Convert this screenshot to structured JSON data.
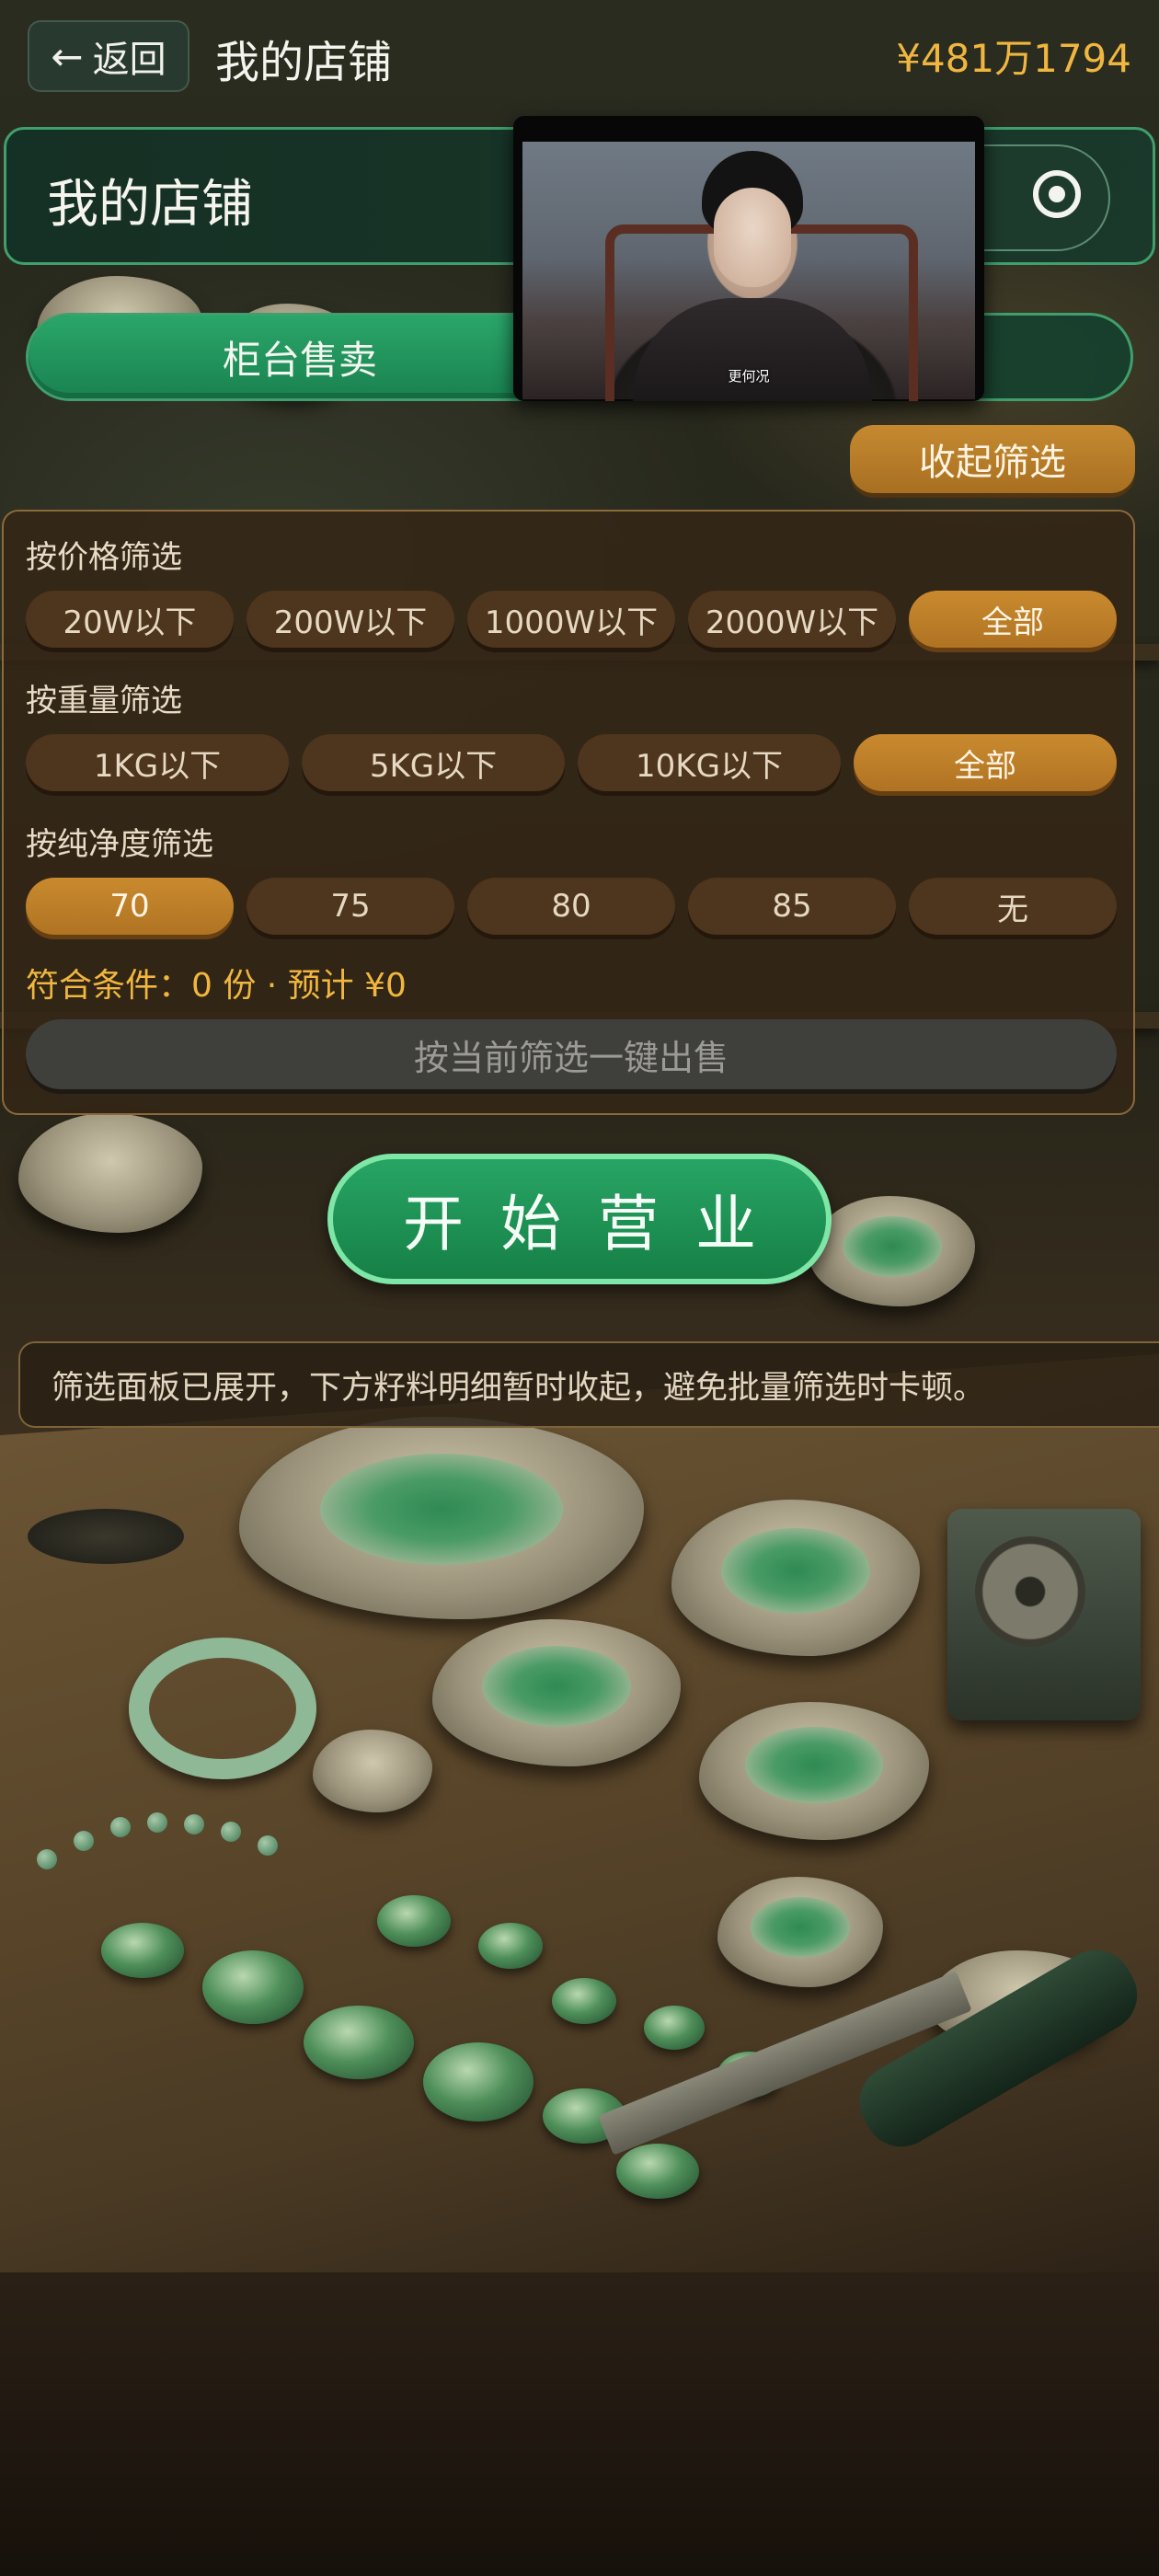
{
  "header": {
    "back_label": "返回",
    "back_icon": "arrow-left-icon",
    "title": "我的店铺",
    "balance": "¥481万1794"
  },
  "shop_card": {
    "name": "我的店铺",
    "radio_icon": "radio-selected-icon"
  },
  "tabs": {
    "active_label": "柜台售卖"
  },
  "video": {
    "caption": "更何况"
  },
  "filter": {
    "collapse_label": "收起筛选",
    "price": {
      "label": "按价格筛选",
      "options": [
        "20W以下",
        "200W以下",
        "1000W以下",
        "2000W以下",
        "全部"
      ],
      "selected": "全部"
    },
    "weight": {
      "label": "按重量筛选",
      "options": [
        "1KG以下",
        "5KG以下",
        "10KG以下",
        "全部"
      ],
      "selected": "全部"
    },
    "purity": {
      "label": "按纯净度筛选",
      "options": [
        "70",
        "75",
        "80",
        "85",
        "无"
      ],
      "selected": "70"
    },
    "summary": "符合条件：0 份 · 预计 ¥0",
    "sell_label": "按当前筛选一键出售"
  },
  "start_label": "开始营业",
  "notice": "筛选面板已展开，下方籽料明细暂时收起，避免批量筛选时卡顿。",
  "colors": {
    "accent_green": "#1f9a5d",
    "accent_gold": "#c0822a",
    "balance_gold": "#f0b63f"
  }
}
